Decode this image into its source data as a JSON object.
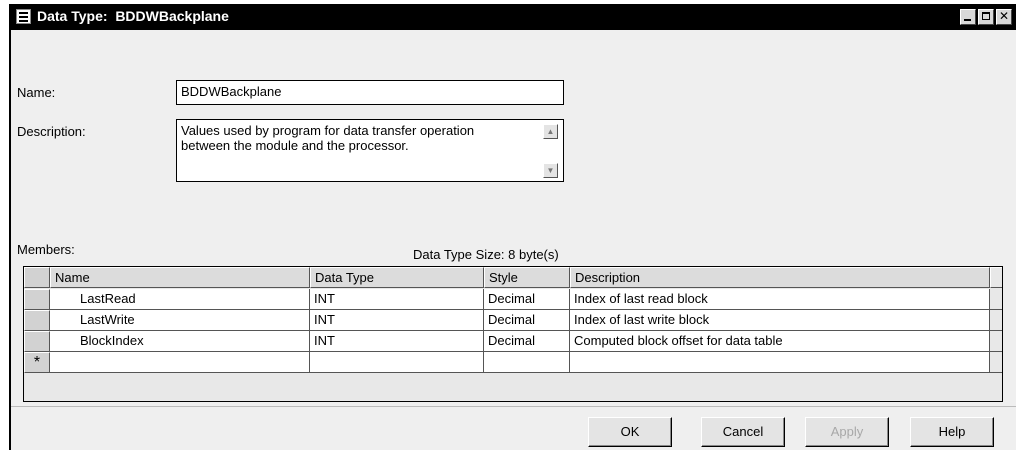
{
  "window": {
    "title": "Data Type:  BDDWBackplane"
  },
  "form": {
    "name_label": "Name:",
    "name_value": "BDDWBackplane",
    "description_label": "Description:",
    "description_line1": "Values used by program for data transfer operation",
    "description_line2": "between the module and the processor.",
    "members_label": "Members:",
    "size_text": "Data Type Size: 8 byte(s)"
  },
  "table": {
    "columns": [
      "Name",
      "Data Type",
      "Style",
      "Description"
    ],
    "rows": [
      {
        "name": "LastRead",
        "type": "INT",
        "style": "Decimal",
        "description": "Index of last read block"
      },
      {
        "name": "LastWrite",
        "type": "INT",
        "style": "Decimal",
        "description": "Index of last write block"
      },
      {
        "name": "BlockIndex",
        "type": "INT",
        "style": "Decimal",
        "description": "Computed block offset for data table"
      }
    ],
    "new_row_marker": "*"
  },
  "buttons": {
    "ok": "OK",
    "cancel": "Cancel",
    "apply": "Apply",
    "help": "Help"
  },
  "icons": {
    "app": "data-type-icon",
    "minimize": "minimize-icon",
    "maximize": "maximize-icon",
    "close": "close-icon"
  },
  "colors": {
    "titlebar": "#000000",
    "dialog": "#efefef",
    "disabled_text": "#a8a8a8"
  }
}
